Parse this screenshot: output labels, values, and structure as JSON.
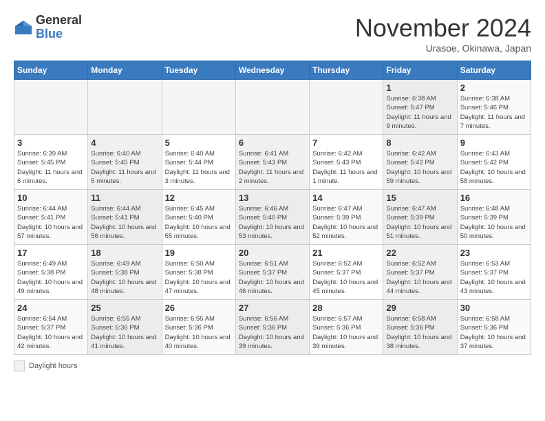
{
  "header": {
    "logo_general": "General",
    "logo_blue": "Blue",
    "month_title": "November 2024",
    "subtitle": "Urasoe, Okinawa, Japan"
  },
  "legend": {
    "label": "Daylight hours"
  },
  "days_of_week": [
    "Sunday",
    "Monday",
    "Tuesday",
    "Wednesday",
    "Thursday",
    "Friday",
    "Saturday"
  ],
  "weeks": [
    [
      {
        "day": "",
        "info": ""
      },
      {
        "day": "",
        "info": ""
      },
      {
        "day": "",
        "info": ""
      },
      {
        "day": "",
        "info": ""
      },
      {
        "day": "",
        "info": ""
      },
      {
        "day": "1",
        "info": "Sunrise: 6:38 AM\nSunset: 5:47 PM\nDaylight: 11 hours and 9 minutes."
      },
      {
        "day": "2",
        "info": "Sunrise: 6:38 AM\nSunset: 5:46 PM\nDaylight: 11 hours and 7 minutes."
      }
    ],
    [
      {
        "day": "3",
        "info": "Sunrise: 6:39 AM\nSunset: 5:45 PM\nDaylight: 11 hours and 6 minutes."
      },
      {
        "day": "4",
        "info": "Sunrise: 6:40 AM\nSunset: 5:45 PM\nDaylight: 11 hours and 5 minutes."
      },
      {
        "day": "5",
        "info": "Sunrise: 6:40 AM\nSunset: 5:44 PM\nDaylight: 11 hours and 3 minutes."
      },
      {
        "day": "6",
        "info": "Sunrise: 6:41 AM\nSunset: 5:43 PM\nDaylight: 11 hours and 2 minutes."
      },
      {
        "day": "7",
        "info": "Sunrise: 6:42 AM\nSunset: 5:43 PM\nDaylight: 11 hours and 1 minute."
      },
      {
        "day": "8",
        "info": "Sunrise: 6:42 AM\nSunset: 5:42 PM\nDaylight: 10 hours and 59 minutes."
      },
      {
        "day": "9",
        "info": "Sunrise: 6:43 AM\nSunset: 5:42 PM\nDaylight: 10 hours and 58 minutes."
      }
    ],
    [
      {
        "day": "10",
        "info": "Sunrise: 6:44 AM\nSunset: 5:41 PM\nDaylight: 10 hours and 57 minutes."
      },
      {
        "day": "11",
        "info": "Sunrise: 6:44 AM\nSunset: 5:41 PM\nDaylight: 10 hours and 56 minutes."
      },
      {
        "day": "12",
        "info": "Sunrise: 6:45 AM\nSunset: 5:40 PM\nDaylight: 10 hours and 55 minutes."
      },
      {
        "day": "13",
        "info": "Sunrise: 6:46 AM\nSunset: 5:40 PM\nDaylight: 10 hours and 53 minutes."
      },
      {
        "day": "14",
        "info": "Sunrise: 6:47 AM\nSunset: 5:39 PM\nDaylight: 10 hours and 52 minutes."
      },
      {
        "day": "15",
        "info": "Sunrise: 6:47 AM\nSunset: 5:39 PM\nDaylight: 10 hours and 51 minutes."
      },
      {
        "day": "16",
        "info": "Sunrise: 6:48 AM\nSunset: 5:39 PM\nDaylight: 10 hours and 50 minutes."
      }
    ],
    [
      {
        "day": "17",
        "info": "Sunrise: 6:49 AM\nSunset: 5:38 PM\nDaylight: 10 hours and 49 minutes."
      },
      {
        "day": "18",
        "info": "Sunrise: 6:49 AM\nSunset: 5:38 PM\nDaylight: 10 hours and 48 minutes."
      },
      {
        "day": "19",
        "info": "Sunrise: 6:50 AM\nSunset: 5:38 PM\nDaylight: 10 hours and 47 minutes."
      },
      {
        "day": "20",
        "info": "Sunrise: 6:51 AM\nSunset: 5:37 PM\nDaylight: 10 hours and 46 minutes."
      },
      {
        "day": "21",
        "info": "Sunrise: 6:52 AM\nSunset: 5:37 PM\nDaylight: 10 hours and 45 minutes."
      },
      {
        "day": "22",
        "info": "Sunrise: 6:52 AM\nSunset: 5:37 PM\nDaylight: 10 hours and 44 minutes."
      },
      {
        "day": "23",
        "info": "Sunrise: 6:53 AM\nSunset: 5:37 PM\nDaylight: 10 hours and 43 minutes."
      }
    ],
    [
      {
        "day": "24",
        "info": "Sunrise: 6:54 AM\nSunset: 5:37 PM\nDaylight: 10 hours and 42 minutes."
      },
      {
        "day": "25",
        "info": "Sunrise: 6:55 AM\nSunset: 5:36 PM\nDaylight: 10 hours and 41 minutes."
      },
      {
        "day": "26",
        "info": "Sunrise: 6:55 AM\nSunset: 5:36 PM\nDaylight: 10 hours and 40 minutes."
      },
      {
        "day": "27",
        "info": "Sunrise: 6:56 AM\nSunset: 5:36 PM\nDaylight: 10 hours and 39 minutes."
      },
      {
        "day": "28",
        "info": "Sunrise: 6:57 AM\nSunset: 5:36 PM\nDaylight: 10 hours and 39 minutes."
      },
      {
        "day": "29",
        "info": "Sunrise: 6:58 AM\nSunset: 5:36 PM\nDaylight: 10 hours and 38 minutes."
      },
      {
        "day": "30",
        "info": "Sunrise: 6:58 AM\nSunset: 5:36 PM\nDaylight: 10 hours and 37 minutes."
      }
    ]
  ]
}
